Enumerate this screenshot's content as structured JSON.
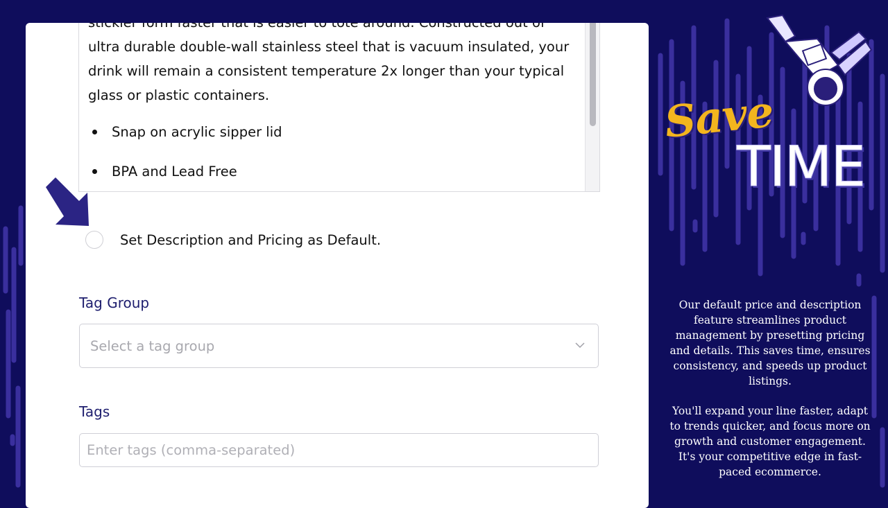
{
  "description": {
    "partial_top_line": "stickier form faster that is easier to tote around. Constructed out of",
    "body": "ultra durable double-wall stainless steel that is vacuum insulated, your drink will remain a consistent temperature 2x longer than your typical glass or plastic containers.",
    "bullets": [
      "Snap on acrylic sipper lid",
      "BPA and Lead Free"
    ]
  },
  "default_option": {
    "label": "Set Description and Pricing as Default.",
    "checked": false
  },
  "tag_group": {
    "label": "Tag Group",
    "placeholder": "Select a tag group"
  },
  "tags": {
    "label": "Tags",
    "placeholder": "Enter tags (comma-separated)"
  },
  "promo": {
    "headline_script": "Save",
    "headline_bold": "TIME",
    "paragraph1": "Our default price and description feature streamlines product management by presetting pricing and details. This saves time, ensures consistency, and speeds up product listings.",
    "paragraph2": "You'll expand your line faster, adapt to trends quicker, and focus more on growth and customer engagement. It's your competitive edge in fast-paced ecommerce."
  },
  "colors": {
    "background": "#0f0d5c",
    "drip": "#3a2f9e",
    "accent_yellow": "#f3b51e",
    "label_navy": "#1e1e6e"
  },
  "icons": [
    "arrow-pointer-icon",
    "chevron-down-icon",
    "astronaut-illustration"
  ]
}
